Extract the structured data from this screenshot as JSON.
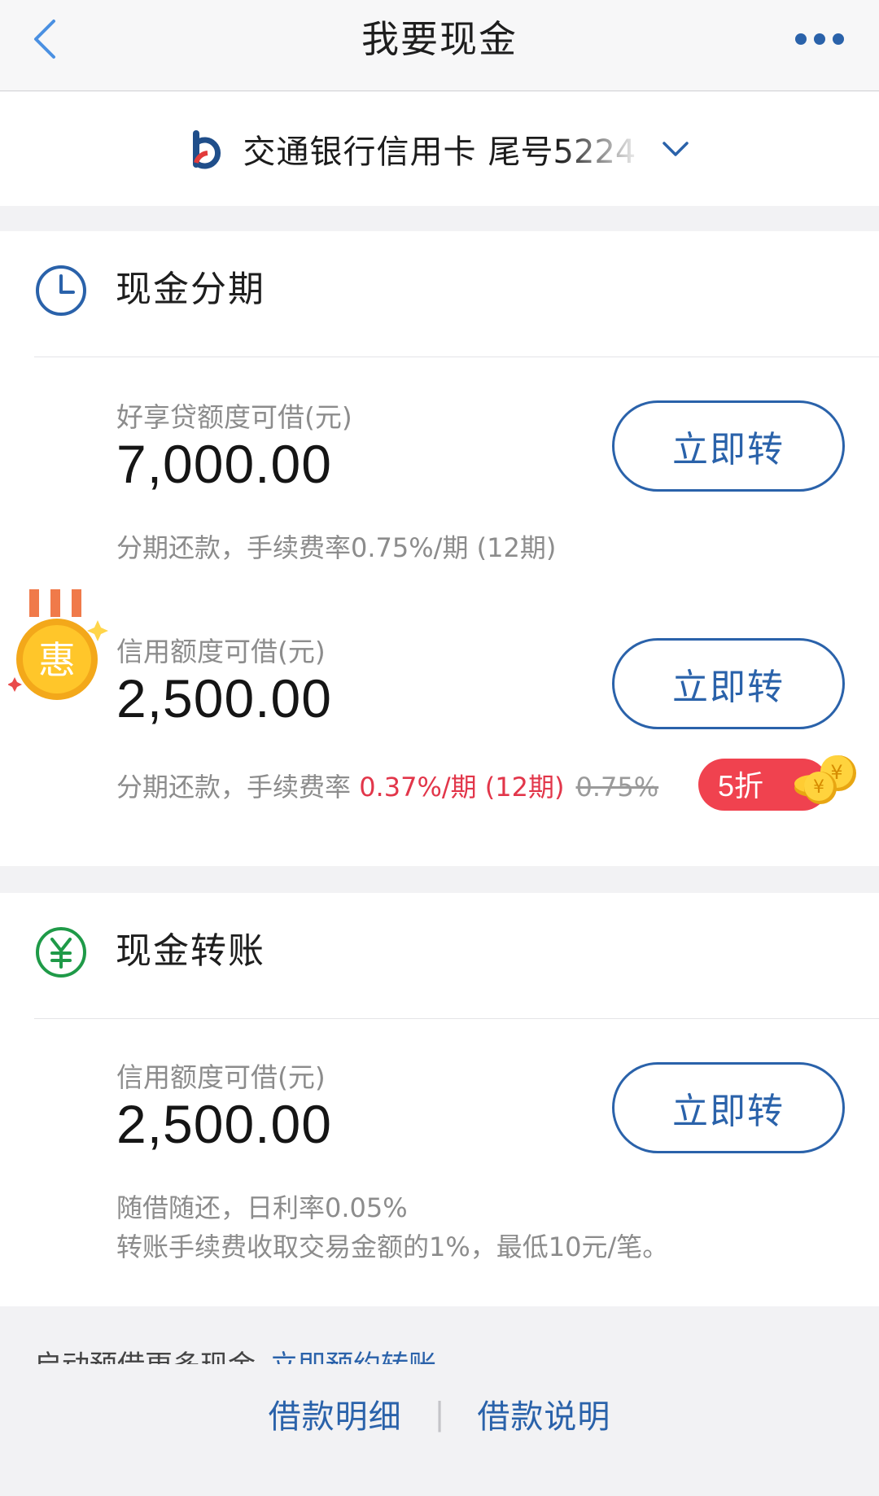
{
  "header": {
    "title": "我要现金",
    "back_icon": "chevron-left-icon",
    "more_icon": "more-dots-icon",
    "accent": "#4a90e2"
  },
  "card": {
    "name": "交通银行信用卡",
    "tail": "尾号5224",
    "logo_icon": "bank-of-communications-logo",
    "dropdown_icon": "chevron-down-icon"
  },
  "installment": {
    "title": "现金分期",
    "icon": "clock-icon",
    "items": [
      {
        "label": "好享贷额度可借(元)",
        "amount": "7,000.00",
        "note": "分期还款，手续费率0.75%/期 (12期)",
        "button": "立即转"
      },
      {
        "label": "信用额度可借(元)",
        "amount": "2,500.00",
        "note_prefix": "分期还款，手续费率 ",
        "note_rate": "0.37%/期 (12期)",
        "note_original": "0.75%",
        "button": "立即转",
        "medal_text": "惠",
        "discount_text": "5折"
      }
    ]
  },
  "transfer": {
    "title": "现金转账",
    "icon": "yuan-circle-icon",
    "item": {
      "label": "信用额度可借(元)",
      "amount": "2,500.00",
      "note_line1": "随借随还，日利率0.05%",
      "note_line2": "转账手续费收取交易金额的1%，最低10元/笔。",
      "button": "立即转"
    }
  },
  "preorder": {
    "text": "启动预借更多现金",
    "link": "立即预约转账"
  },
  "footer": {
    "link_details": "借款明细",
    "separator": "|",
    "link_instructions": "借款说明"
  },
  "colors": {
    "brand_blue": "#2a62aa",
    "promo_red": "#e2364a",
    "green": "#1f9a48"
  }
}
